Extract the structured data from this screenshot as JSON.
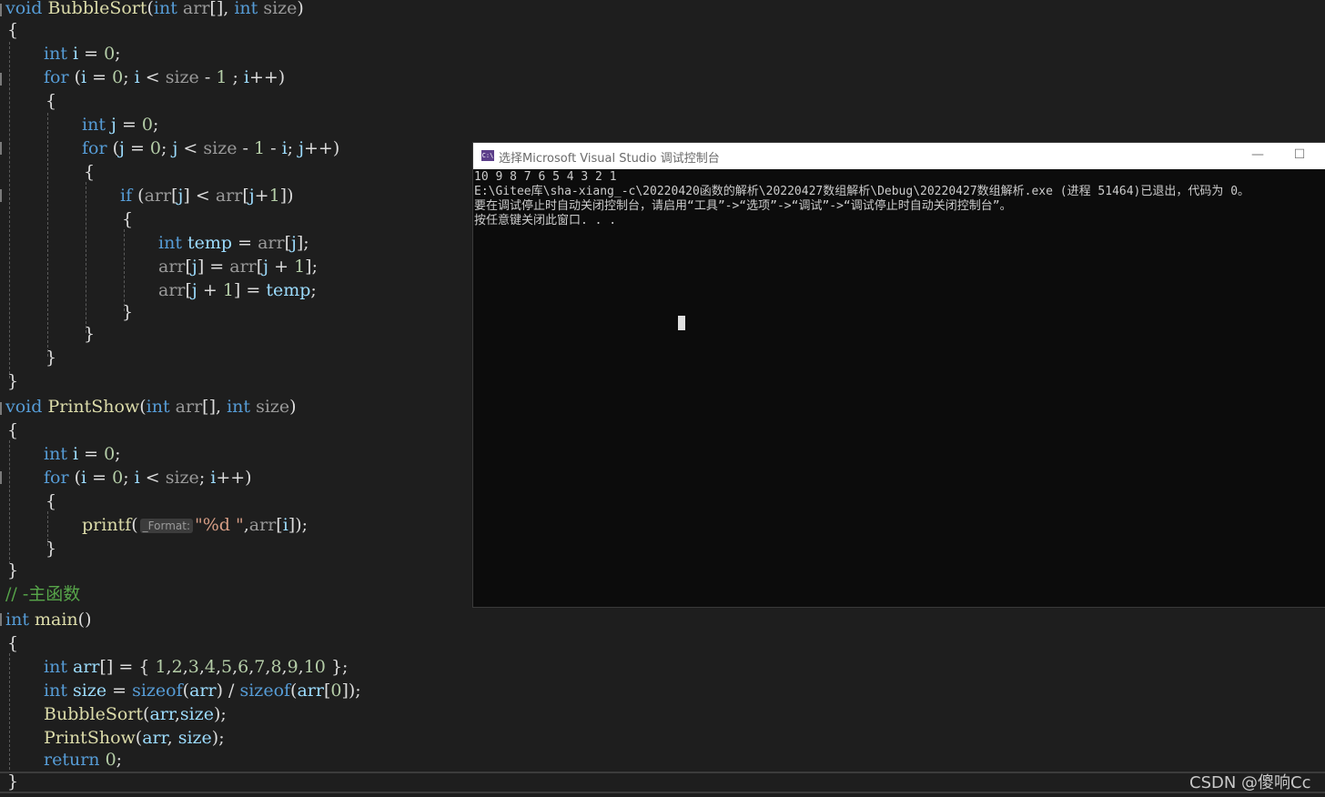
{
  "editor": {
    "lines": [
      [
        [
          "kw",
          "void"
        ],
        [
          "p",
          " "
        ],
        [
          "fn",
          "BubbleSort"
        ],
        [
          "p",
          "("
        ],
        [
          "kw",
          "int"
        ],
        [
          "p",
          " "
        ],
        [
          "param",
          "arr"
        ],
        [
          "p",
          "[], "
        ],
        [
          "kw",
          "int"
        ],
        [
          "p",
          " "
        ],
        [
          "param",
          "size"
        ],
        [
          "p",
          ")"
        ]
      ],
      [
        [
          "p",
          "{"
        ]
      ],
      [
        [
          "kw",
          "int"
        ],
        [
          "p",
          " "
        ],
        [
          "var",
          "i"
        ],
        [
          "p",
          " = "
        ],
        [
          "num",
          "0"
        ],
        [
          "p",
          ";"
        ]
      ],
      [
        [
          "kw",
          "for"
        ],
        [
          "p",
          " ("
        ],
        [
          "var",
          "i"
        ],
        [
          "p",
          " = "
        ],
        [
          "num",
          "0"
        ],
        [
          "p",
          "; "
        ],
        [
          "var",
          "i"
        ],
        [
          "p",
          " < "
        ],
        [
          "param",
          "size"
        ],
        [
          "p",
          " - "
        ],
        [
          "num",
          "1"
        ],
        [
          "p",
          " ; "
        ],
        [
          "var",
          "i"
        ],
        [
          "p",
          "++)"
        ]
      ],
      [
        [
          "p",
          "{"
        ]
      ],
      [
        [
          "kw",
          "int"
        ],
        [
          "p",
          " "
        ],
        [
          "var",
          "j"
        ],
        [
          "p",
          " = "
        ],
        [
          "num",
          "0"
        ],
        [
          "p",
          ";"
        ]
      ],
      [
        [
          "kw",
          "for"
        ],
        [
          "p",
          " ("
        ],
        [
          "var",
          "j"
        ],
        [
          "p",
          " = "
        ],
        [
          "num",
          "0"
        ],
        [
          "p",
          "; "
        ],
        [
          "var",
          "j"
        ],
        [
          "p",
          " < "
        ],
        [
          "param",
          "size"
        ],
        [
          "p",
          " - "
        ],
        [
          "num",
          "1"
        ],
        [
          "p",
          " - "
        ],
        [
          "var",
          "i"
        ],
        [
          "p",
          "; "
        ],
        [
          "var",
          "j"
        ],
        [
          "p",
          "++)"
        ]
      ],
      [
        [
          "p",
          "{"
        ]
      ],
      [
        [
          "kw",
          "if"
        ],
        [
          "p",
          " ("
        ],
        [
          "param",
          "arr"
        ],
        [
          "p",
          "["
        ],
        [
          "var",
          "j"
        ],
        [
          "p",
          "] < "
        ],
        [
          "param",
          "arr"
        ],
        [
          "p",
          "["
        ],
        [
          "var",
          "j"
        ],
        [
          "p",
          "+"
        ],
        [
          "num",
          "1"
        ],
        [
          "p",
          "])"
        ]
      ],
      [
        [
          "p",
          "{"
        ]
      ],
      [
        [
          "kw",
          "int"
        ],
        [
          "p",
          " "
        ],
        [
          "var",
          "temp"
        ],
        [
          "p",
          " = "
        ],
        [
          "param",
          "arr"
        ],
        [
          "p",
          "["
        ],
        [
          "var",
          "j"
        ],
        [
          "p",
          "];"
        ]
      ],
      [
        [
          "param",
          "arr"
        ],
        [
          "p",
          "["
        ],
        [
          "var",
          "j"
        ],
        [
          "p",
          "] = "
        ],
        [
          "param",
          "arr"
        ],
        [
          "p",
          "["
        ],
        [
          "var",
          "j"
        ],
        [
          "p",
          " + "
        ],
        [
          "num",
          "1"
        ],
        [
          "p",
          "];"
        ]
      ],
      [
        [
          "param",
          "arr"
        ],
        [
          "p",
          "["
        ],
        [
          "var",
          "j"
        ],
        [
          "p",
          " + "
        ],
        [
          "num",
          "1"
        ],
        [
          "p",
          "] = "
        ],
        [
          "var",
          "temp"
        ],
        [
          "p",
          ";"
        ]
      ],
      [
        [
          "p",
          "}"
        ]
      ],
      [
        [
          "p",
          "}"
        ]
      ],
      [
        [
          "p",
          "}"
        ]
      ],
      [
        [
          "p",
          "}"
        ]
      ],
      [
        [
          "kw",
          "void"
        ],
        [
          "p",
          " "
        ],
        [
          "fn",
          "PrintShow"
        ],
        [
          "p",
          "("
        ],
        [
          "kw",
          "int"
        ],
        [
          "p",
          " "
        ],
        [
          "param",
          "arr"
        ],
        [
          "p",
          "[], "
        ],
        [
          "kw",
          "int"
        ],
        [
          "p",
          " "
        ],
        [
          "param",
          "size"
        ],
        [
          "p",
          ")"
        ]
      ],
      [
        [
          "p",
          "{"
        ]
      ],
      [
        [
          "kw",
          "int"
        ],
        [
          "p",
          " "
        ],
        [
          "var",
          "i"
        ],
        [
          "p",
          " = "
        ],
        [
          "num",
          "0"
        ],
        [
          "p",
          ";"
        ]
      ],
      [
        [
          "kw",
          "for"
        ],
        [
          "p",
          " ("
        ],
        [
          "var",
          "i"
        ],
        [
          "p",
          " = "
        ],
        [
          "num",
          "0"
        ],
        [
          "p",
          "; "
        ],
        [
          "var",
          "i"
        ],
        [
          "p",
          " < "
        ],
        [
          "param",
          "size"
        ],
        [
          "p",
          "; "
        ],
        [
          "var",
          "i"
        ],
        [
          "p",
          "++)"
        ]
      ],
      [
        [
          "p",
          "{"
        ]
      ],
      [
        [
          "fn",
          "printf"
        ],
        [
          "p",
          "("
        ],
        [
          "hint",
          "_Format:"
        ],
        [
          "str",
          "\"%d \""
        ],
        [
          "p",
          ","
        ],
        [
          "param",
          "arr"
        ],
        [
          "p",
          "["
        ],
        [
          "var",
          "i"
        ],
        [
          "p",
          "]);"
        ]
      ],
      [
        [
          "p",
          "}"
        ]
      ],
      [
        [
          "p",
          "}"
        ]
      ],
      [
        [
          "cmt",
          "// -主函数"
        ]
      ],
      [
        [
          "kw",
          "int"
        ],
        [
          "p",
          " "
        ],
        [
          "fn",
          "main"
        ],
        [
          "p",
          "()"
        ]
      ],
      [
        [
          "p",
          "{"
        ]
      ],
      [
        [
          "kw",
          "int"
        ],
        [
          "p",
          " "
        ],
        [
          "var",
          "arr"
        ],
        [
          "p",
          "[] = { "
        ],
        [
          "num",
          "1"
        ],
        [
          "p",
          ","
        ],
        [
          "num",
          "2"
        ],
        [
          "p",
          ","
        ],
        [
          "num",
          "3"
        ],
        [
          "p",
          ","
        ],
        [
          "num",
          "4"
        ],
        [
          "p",
          ","
        ],
        [
          "num",
          "5"
        ],
        [
          "p",
          ","
        ],
        [
          "num",
          "6"
        ],
        [
          "p",
          ","
        ],
        [
          "num",
          "7"
        ],
        [
          "p",
          ","
        ],
        [
          "num",
          "8"
        ],
        [
          "p",
          ","
        ],
        [
          "num",
          "9"
        ],
        [
          "p",
          ","
        ],
        [
          "num",
          "10"
        ],
        [
          "p",
          " };"
        ]
      ],
      [
        [
          "kw",
          "int"
        ],
        [
          "p",
          " "
        ],
        [
          "var",
          "size"
        ],
        [
          "p",
          " = "
        ],
        [
          "kw",
          "sizeof"
        ],
        [
          "p",
          "("
        ],
        [
          "var",
          "arr"
        ],
        [
          "p",
          ") / "
        ],
        [
          "kw",
          "sizeof"
        ],
        [
          "p",
          "("
        ],
        [
          "var",
          "arr"
        ],
        [
          "p",
          "["
        ],
        [
          "num",
          "0"
        ],
        [
          "p",
          "]);"
        ]
      ],
      [
        [
          "fn",
          "BubbleSort"
        ],
        [
          "p",
          "("
        ],
        [
          "var",
          "arr"
        ],
        [
          "p",
          ","
        ],
        [
          "var",
          "size"
        ],
        [
          "p",
          ");"
        ]
      ],
      [
        [
          "fn",
          "PrintShow"
        ],
        [
          "p",
          "("
        ],
        [
          "var",
          "arr"
        ],
        [
          "p",
          ", "
        ],
        [
          "var",
          "size"
        ],
        [
          "p",
          ");"
        ]
      ],
      [
        [
          "kw",
          "return"
        ],
        [
          "p",
          " "
        ],
        [
          "num",
          "0"
        ],
        [
          "p",
          ";"
        ]
      ],
      [
        [
          "p",
          "}"
        ]
      ]
    ]
  },
  "console": {
    "title": "选择Microsoft Visual Studio 调试控制台",
    "icon_label": "C:\\",
    "minimize_icon": "minimize-icon",
    "maximize_icon": "maximize-icon",
    "lines": [
      "10 9 8 7 6 5 4 3 2 1",
      "E:\\Gitee库\\sha-xiang_-c\\20220420函数的解析\\20220427数组解析\\Debug\\20220427数组解析.exe (进程 51464)已退出，代码为 0。",
      "要在调试停止时自动关闭控制台，请启用“工具”->“选项”->“调试”->“调试停止时自动关闭控制台”。",
      "按任意键关闭此窗口. . ."
    ]
  },
  "watermark": "CSDN @傻响Cc",
  "colors": {
    "editor_bg": "#1e1e1e",
    "keyword": "#569cd6",
    "function": "#dcdcaa",
    "variable": "#9cdcfe",
    "console_bg": "#0c0c0c"
  }
}
